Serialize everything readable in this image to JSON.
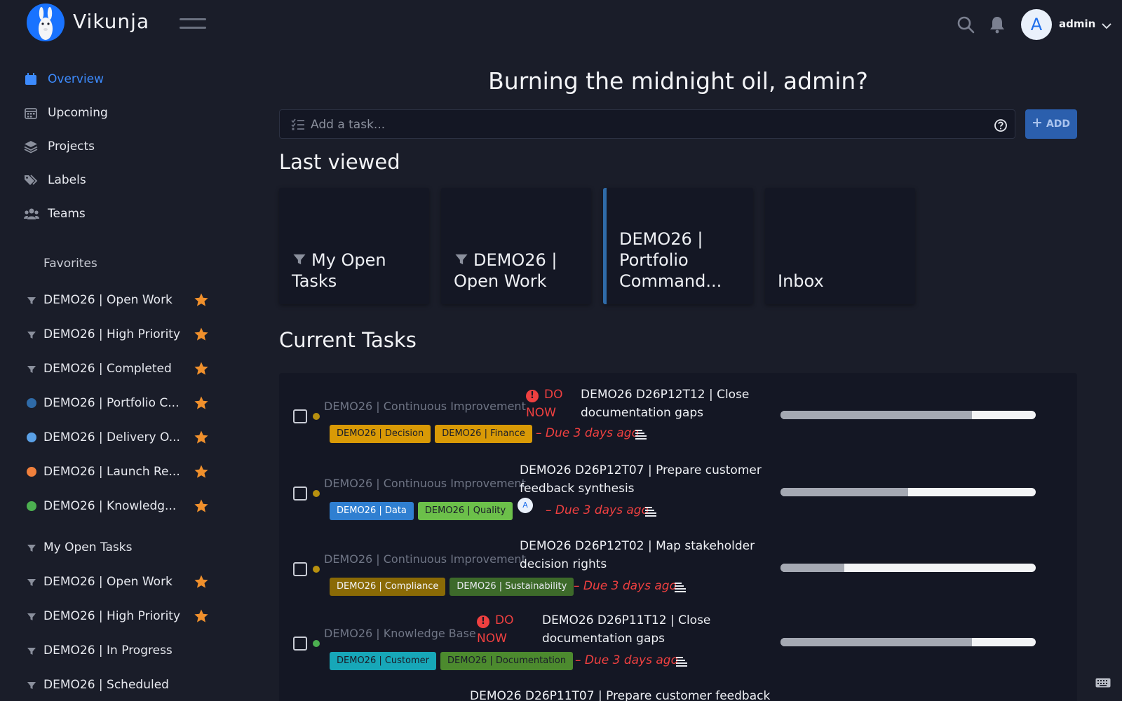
{
  "app": {
    "brand": "Vikunja"
  },
  "user": {
    "avatar_letter": "A",
    "name": "admin"
  },
  "nav": [
    {
      "label": "Overview",
      "icon": "calendar-icon",
      "active": true
    },
    {
      "label": "Upcoming",
      "icon": "calendar-grid-icon"
    },
    {
      "label": "Projects",
      "icon": "layers-icon"
    },
    {
      "label": "Labels",
      "icon": "tags-icon"
    },
    {
      "label": "Teams",
      "icon": "users-icon"
    }
  ],
  "favorites": {
    "heading": "Favorites",
    "items": [
      {
        "label": "DEMO26 | Open Work",
        "marker": "filter",
        "color": "#8b909d",
        "starred": true
      },
      {
        "label": "DEMO26 | High Priority",
        "marker": "filter",
        "color": "#8b909d",
        "starred": true
      },
      {
        "label": "DEMO26 | Completed",
        "marker": "filter",
        "color": "#8b909d",
        "starred": true
      },
      {
        "label": "DEMO26 | Portfolio C...",
        "marker": "dot",
        "color": "#2f6ba8",
        "starred": true
      },
      {
        "label": "DEMO26 | Delivery O...",
        "marker": "dot",
        "color": "#5aa0e6",
        "starred": true
      },
      {
        "label": "DEMO26 | Launch Re...",
        "marker": "dot",
        "color": "#f0803c",
        "starred": true
      },
      {
        "label": "DEMO26 | Knowledg...",
        "marker": "dot",
        "color": "#4caf50",
        "starred": true
      }
    ]
  },
  "saved_filters": [
    {
      "label": "My Open Tasks",
      "starred": false
    },
    {
      "label": "DEMO26 | Open Work",
      "starred": true
    },
    {
      "label": "DEMO26 | High Priority",
      "starred": true
    },
    {
      "label": "DEMO26 | In Progress",
      "starred": false
    },
    {
      "label": "DEMO26 | Scheduled",
      "starred": false
    }
  ],
  "main": {
    "greeting": "Burning the midnight oil, admin?",
    "add_task": {
      "placeholder": "Add a task...",
      "button_label": "ADD"
    },
    "last_viewed": {
      "title": "Last viewed",
      "cards": [
        {
          "title": "My Open Tasks",
          "is_filter": true,
          "accent": false
        },
        {
          "title": "DEMO26 | Open Work",
          "is_filter": true,
          "accent": false
        },
        {
          "title": "DEMO26 | Portfolio Command...",
          "is_filter": false,
          "accent": true
        },
        {
          "title": "Inbox",
          "is_filter": false,
          "accent": false
        }
      ]
    },
    "current_tasks": {
      "title": "Current Tasks",
      "tasks": [
        {
          "project": "DEMO26 | Continuous Improvement",
          "project_color": "#b8900f",
          "do_now": "DO NOW",
          "title": "DEMO26 D26P12T12 | Close documentation gaps",
          "labels": [
            {
              "text": "DEMO26 | Decision",
              "bg": "#d99a06",
              "fg": "#1a1d29"
            },
            {
              "text": "DEMO26 | Finance",
              "bg": "#d99a06",
              "fg": "#1a1d29"
            }
          ],
          "due": "– Due 3 days ago",
          "progress": 0.75,
          "assignee": null
        },
        {
          "project": "DEMO26 | Continuous Improvement",
          "project_color": "#b8900f",
          "do_now": null,
          "title": "DEMO26 D26P12T07 | Prepare customer feedback synthesis",
          "labels": [
            {
              "text": "DEMO26 | Data",
              "bg": "#2f7fd1",
              "fg": "#ffffff"
            },
            {
              "text": "DEMO26 | Quality",
              "bg": "#6cc04a",
              "fg": "#1a1d29"
            }
          ],
          "due": "– Due 3 days ago",
          "progress": 0.5,
          "assignee": "A"
        },
        {
          "project": "DEMO26 | Continuous Improvement",
          "project_color": "#b8900f",
          "do_now": null,
          "title": "DEMO26 D26P12T02 | Map stakeholder decision rights",
          "labels": [
            {
              "text": "DEMO26 | Compliance",
              "bg": "#8a6a06",
              "fg": "#f2f3f6"
            },
            {
              "text": "DEMO26 | Sustainability",
              "bg": "#3d6a2a",
              "fg": "#e7e9ef"
            }
          ],
          "due": "– Due 3 days ago",
          "progress": 0.25,
          "assignee": null
        },
        {
          "project": "DEMO26 | Knowledge Base",
          "project_color": "#4caf50",
          "do_now": "DO NOW",
          "title": "DEMO26 D26P11T12 | Close documentation gaps",
          "labels": [
            {
              "text": "DEMO26 | Customer",
              "bg": "#17a7b8",
              "fg": "#1a1d29"
            },
            {
              "text": "DEMO26 | Documentation",
              "bg": "#4c8a2e",
              "fg": "#1a1d29"
            }
          ],
          "due": "– Due 3 days ago",
          "progress": 0.75,
          "assignee": null
        }
      ],
      "partial_title": "DEMO26 D26P11T07 | Prepare customer feedback"
    }
  },
  "colors": {
    "accent": "#3d8bfd",
    "star": "#f0902c",
    "overdue": "#ef4040",
    "background": "#1a1d29",
    "panel": "#141724"
  }
}
